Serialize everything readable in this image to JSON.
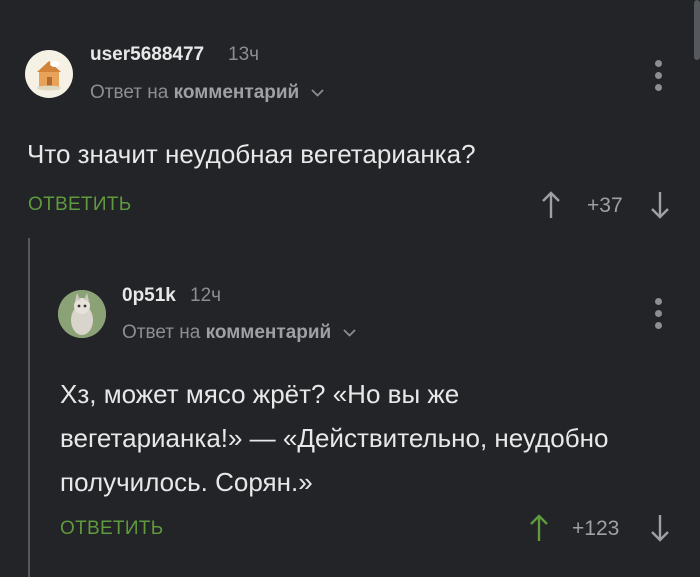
{
  "comments": [
    {
      "username": "user5688477",
      "time": "13ч",
      "reply_prefix": "Ответ на",
      "reply_target": "комментарий",
      "text": "Что значит неудобная вегетарианка?",
      "reply_label": "ОТВЕТИТЬ",
      "rating": "+37",
      "upvoted": false
    },
    {
      "username": "0p51k",
      "time": "12ч",
      "reply_prefix": "Ответ на",
      "reply_target": "комментарий",
      "text_lines": [
        "Хз, может мясо жрёт? «Но вы же",
        "вегетарианка!» — «Действительно, неудобно",
        "получилось. Сорян.»"
      ],
      "reply_label": "ОТВЕТИТЬ",
      "rating": "+123",
      "upvoted": true
    }
  ],
  "colors": {
    "background": "#222427",
    "accent_green": "#5f9a3d",
    "muted": "#8c8e92"
  }
}
